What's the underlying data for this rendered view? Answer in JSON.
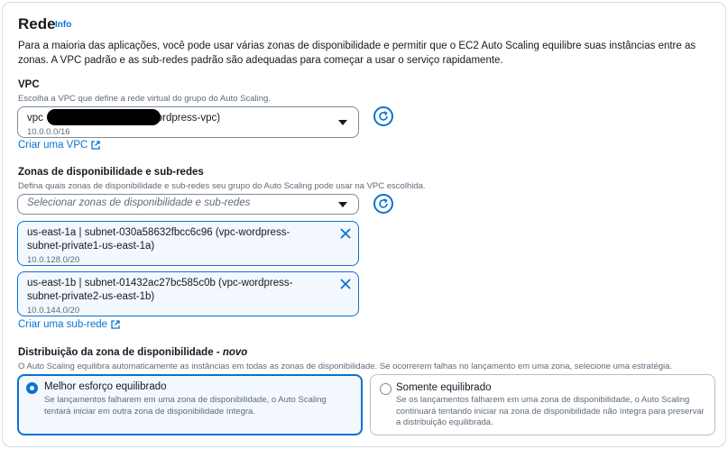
{
  "section": {
    "title": "Rede",
    "info_label": "Info",
    "intro": "Para a maioria das aplicações, você pode usar várias zonas de disponibilidade e permitir que o EC2 Auto Scaling equilibre suas instâncias entre as zonas. A VPC padrão e as sub-redes padrão são adequadas para começar a usar o serviço rapidamente."
  },
  "vpc": {
    "label": "VPC",
    "description": "Escolha a VPC que define a rede virtual do grupo do Auto Scaling.",
    "selected_prefix": "vpc",
    "selected_suffix": "(vpc-wordpress-vpc)",
    "selected_cidr": "10.0.0.0/16",
    "create_link": "Criar uma VPC",
    "icons": {
      "dropdown": "caret-down-icon",
      "refresh": "refresh-icon",
      "external": "external-link-icon"
    }
  },
  "zones": {
    "label": "Zonas de disponibilidade e sub-redes",
    "description": "Defina quais zonas de disponibilidade e sub-redes seu grupo do Auto Scaling pode usar na VPC escolhida.",
    "placeholder": "Selecionar zonas de disponibilidade e sub-redes",
    "tokens": [
      {
        "text": "us-east-1a | subnet-030a58632fbcc6c96 (vpc-wordpress-subnet-private1-us-east-1a)",
        "cidr": "10.0.128.0/20"
      },
      {
        "text": "us-east-1b | subnet-01432ac27bc585c0b (vpc-wordpress-subnet-private2-us-east-1b)",
        "cidr": "10.0.144.0/20"
      }
    ],
    "create_link": "Criar uma sub-rede"
  },
  "distribution": {
    "label": "Distribuição da zona de disponibilidade",
    "label_badge": "novo",
    "description": "O Auto Scaling equilibra automaticamente as instâncias em todas as zonas de disponibilidade. Se ocorrerem falhas no lançamento em uma zona, selecione uma estratégia.",
    "options": [
      {
        "title": "Melhor esforço equilibrado",
        "desc": "Se lançamentos falharem em uma zona de disponibilidade, o Auto Scaling tentará iniciar em outra zona de disponibilidade íntegra.",
        "selected": true
      },
      {
        "title": "Somente equilibrado",
        "desc": "Se os lançamentos falharem em uma zona de disponibilidade, o Auto Scaling continuará tentando iniciar na zona de disponibilidade não íntegra para preservar a distribuição equilibrada.",
        "selected": false
      }
    ]
  },
  "colors": {
    "accent": "#0972d3",
    "text": "#16191f",
    "muted": "#5f6b7a",
    "border": "#7d8998",
    "selected_bg": "#f2f8fd"
  }
}
